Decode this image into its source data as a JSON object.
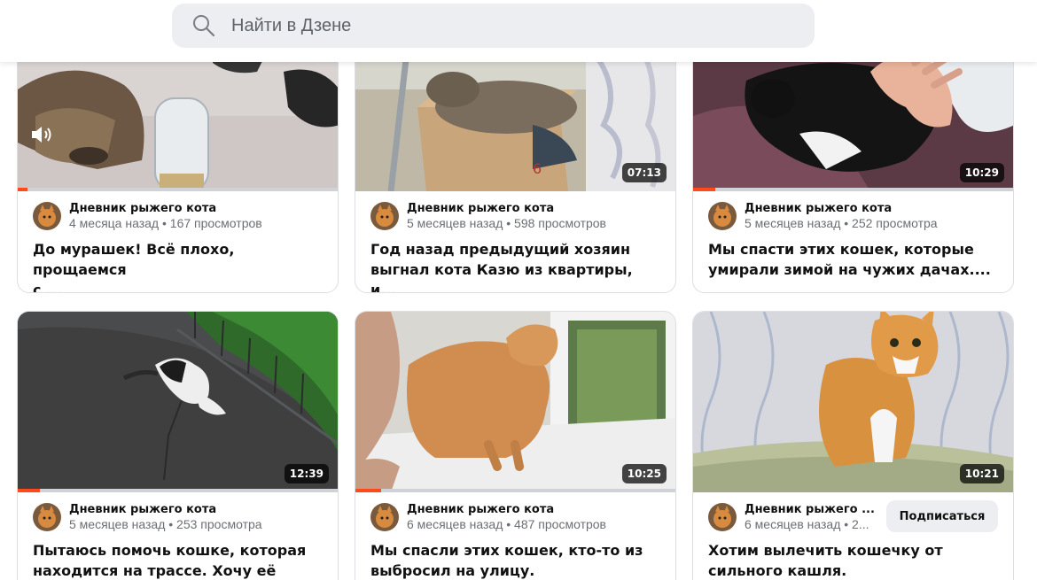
{
  "search": {
    "placeholder": "Найти в Дзене"
  },
  "colors": {
    "accent": "#ff4a1c",
    "search_bg": "#eceef1"
  },
  "cards": [
    {
      "channel": "Дневник рыжего кота",
      "stats": "4 месяца назад • 167 просмотров",
      "title_line1": "До мурашек! Всё плохо, прощаемся",
      "title_line2": "с ...",
      "duration": "",
      "progress": 0.03,
      "icon": "speaker-icon"
    },
    {
      "channel": "Дневник рыжего кота",
      "stats": "5 месяцев назад • 598 просмотров",
      "title_line1": "Год назад предыдущий хозяин",
      "title_line2": "выгнал кота Казю из квартиры, и...",
      "duration": "07:13",
      "progress": 0.0
    },
    {
      "channel": "Дневник рыжего кота",
      "stats": "5 месяцев назад • 252 просмотра",
      "title_line1": "Мы спасти этих кошек, которые",
      "title_line2": "умирали зимой на чужих дачах....",
      "duration": "10:29",
      "progress": 0.07
    },
    {
      "channel": "Дневник рыжего кота",
      "stats": "5 месяцев назад • 253 просмотра",
      "title_line1": "Пытаюсь помочь кошке, которая",
      "title_line2": "находится на трассе. Хочу её унес...",
      "duration": "12:39",
      "progress": 0.07
    },
    {
      "channel": "Дневник рыжего кота",
      "stats": "6 месяцев назад • 487 просмотров",
      "title_line1": "Мы спасли этих кошек, кто-то из",
      "title_line2": "выбросил на улицу.",
      "duration": "10:25",
      "progress": 0.08
    },
    {
      "channel": "Дневник рыжего ...",
      "stats": "6 месяцев назад • 2...",
      "title_line1": "Хотим вылечить кошечку от",
      "title_line2": "сильного кашля.",
      "duration": "10:21",
      "progress": 0.0,
      "subscribe_label": "Подписаться"
    }
  ]
}
